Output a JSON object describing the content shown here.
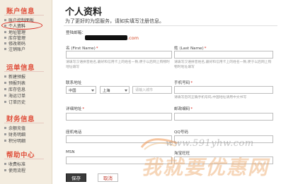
{
  "sidebar": {
    "sections": [
      {
        "title": "账户信息",
        "items": [
          "账户控制面板",
          "个人资料",
          "地址管理",
          "库存管理",
          "修改密码",
          "注销账户"
        ]
      },
      {
        "title": "运单信息",
        "items": [
          "新建预报",
          "预报列表",
          "库存信息",
          "海运订单",
          "订单历史"
        ]
      },
      {
        "title": "财务信息",
        "items": [
          "余额充值",
          "财务明细",
          "积分明细"
        ]
      },
      {
        "title": "帮助中心",
        "items": [
          "收费标准",
          "使用流程"
        ]
      }
    ],
    "active_item": "个人资料"
  },
  "header": {
    "title": "个人资料",
    "subtitle": "为了更好的为您服务，请如实填写注册信息。"
  },
  "form": {
    "email_label": "登陆邮箱：",
    "email_domain": ".com",
    "first_name_label": "名 (First Name)",
    "last_name_label": "姓 (Last Name)",
    "name_hint": "请填写汉语拼音姓名,最好和信用卡上的姓名一致,便于以后网上购物时地址填写",
    "address_label": "联系地址",
    "country_value": "中国",
    "province_value": "上海",
    "city_placeholder": "请输入城市",
    "phone_label": "手机号码",
    "phone_hint": "请填写您的正确手机号码,中国地址请用中文书写",
    "detail_address_label": "详细地址",
    "postcode_label": "邮政编码",
    "home_phone_label": "座机电话",
    "qq_label": "QQ号码",
    "msn_label": "MSN",
    "secondary_label": "淘宝旺旺",
    "save_label": "保存",
    "cancel_label": "取消"
  },
  "watermark": {
    "url": "www.591yhw.com",
    "text": "我就要优惠网"
  },
  "colors": {
    "sidebar_bg": "#f3ecdf",
    "section_title": "#e0503c",
    "required": "#d9251c",
    "save_button": "#3a3a3a",
    "highlight": "#d9251c"
  }
}
